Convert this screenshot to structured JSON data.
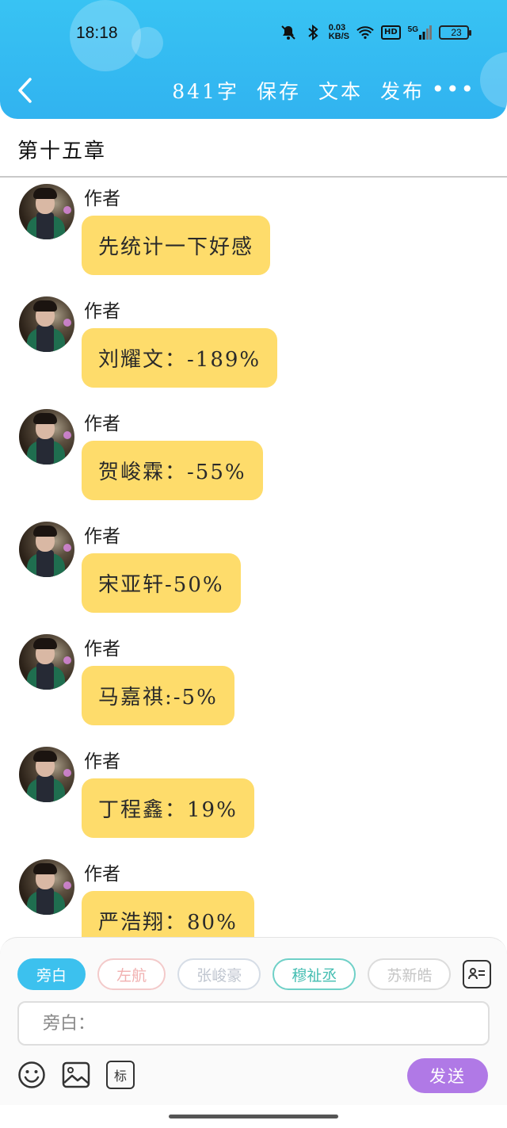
{
  "status_bar": {
    "time": "18:18",
    "net_speed_value": "0.03",
    "net_speed_unit": "KB/S",
    "hd": "HD",
    "signal": "5G",
    "battery": "23",
    "icons": [
      "mute-bell-icon",
      "bluetooth-icon",
      "wifi-icon",
      "signal-icon",
      "battery-icon"
    ]
  },
  "toolbar": {
    "word_count": "841字",
    "save": "保存",
    "text": "文本",
    "publish": "发布",
    "more": "•••"
  },
  "chapter": {
    "title": "第十五章"
  },
  "messages": [
    {
      "author": "作者",
      "text": "先统计一下好感"
    },
    {
      "author": "作者",
      "text": "刘耀文：-189%"
    },
    {
      "author": "作者",
      "text": "贺峻霖：-55%"
    },
    {
      "author": "作者",
      "text": "宋亚轩-50%"
    },
    {
      "author": "作者",
      "text": "马嘉祺:-5%"
    },
    {
      "author": "作者",
      "text": "丁程鑫：19%"
    },
    {
      "author": "作者",
      "text": "严浩翔：80%"
    }
  ],
  "composer": {
    "roles": [
      "旁白",
      "左航",
      "张峻豪",
      "穆祉丞",
      "苏新皓"
    ],
    "input_placeholder": "旁白：",
    "tag_label": "标",
    "send": "发送"
  },
  "colors": {
    "header": "#38c3f3",
    "bubble": "#fedc6b",
    "send_button": "#b079e6",
    "active_role": "#3cc1ee"
  }
}
